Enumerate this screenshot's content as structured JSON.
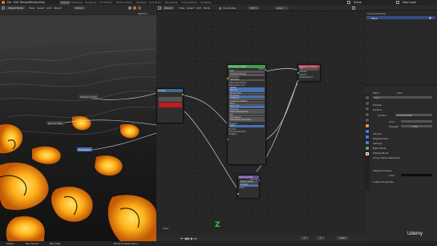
{
  "topbar": {
    "menus": [
      "File",
      "Edit",
      "Render",
      "Window",
      "Help"
    ],
    "workspaces": [
      "Layout",
      "Modeling",
      "Sculpting",
      "UV Editing",
      "Texture Paint",
      "Shading",
      "Animation",
      "Rendering",
      "Compositing",
      "Scripting"
    ],
    "active_workspace": "Layout",
    "scene": "Scene",
    "view_layer": "View Layer"
  },
  "viewport": {
    "mode": "Object Mode",
    "menus": [
      "View",
      "Select",
      "Add",
      "Object"
    ],
    "transform": "Global",
    "labels": [
      "Displacement",
      "Normal Map",
      "Principled"
    ],
    "header_extra": "Options"
  },
  "node_editor": {
    "editor_type": "Object",
    "menus": [
      "View",
      "Select",
      "Add",
      "Node"
    ],
    "use_nodes_label": "Use Nodes",
    "slot": "Slot 1",
    "material": "Lava",
    "footer_label": "Lava",
    "gizmo_axis": "Z"
  },
  "nodes": {
    "bsdf": {
      "title": "Principled BSDF",
      "rows": [
        "BSDF",
        "GGX",
        "Christensen-Burley",
        "Base Color",
        "Subsurface",
        "Subsurface Radius",
        "Subsurface Color",
        "Metallic",
        "Specular",
        "Specular Tint",
        "Roughness",
        "Anisotropic",
        "Anisotropic Rotation",
        "Sheen",
        "Sheen Tint",
        "Clearcoat",
        "Clearcoat Roughness",
        "IOR",
        "Transmission",
        "Transmission Roughness",
        "Emission",
        "Alpha",
        "Normal",
        "Clearcoat Normal",
        "Tangent"
      ]
    },
    "output": {
      "title": "Material Output",
      "rows": [
        "All",
        "Surface",
        "Volume",
        "Displacement"
      ]
    },
    "normal": {
      "title": "Normal Map",
      "rows": [
        "Normal",
        "Tangent Space",
        "Strength",
        "Color"
      ]
    },
    "left": {
      "title": "Image"
    }
  },
  "outliner": {
    "title": "Scene Collection",
    "items": [
      "Scene Collection",
      "Plane"
    ]
  },
  "properties": {
    "object_name": "Plane",
    "tab_label": "Lava",
    "sections": [
      "Preview",
      "Surface",
      "Volume",
      "Displacement",
      "Settings"
    ],
    "surface_label": "Surface",
    "surface_value": "Principled BSDF",
    "displacement_label": "Displacement",
    "color_label": "Color",
    "strength_label": "Strength",
    "strength_value": "1.000",
    "subsections": [
      "Volume",
      "Displacement",
      "Settings",
      "Blend Mode",
      "Shadow Mode",
      "Screen Space Refraction"
    ],
    "viewport_display": "Viewport Display",
    "custom_properties": "Custom Properties",
    "color_header": "Color"
  },
  "timeline": {
    "frame": "1",
    "start": "1",
    "end": "250"
  },
  "statusbar": {
    "left_items": [
      "Select",
      "Box Select",
      "Pan View",
      "Node Context Menu"
    ],
    "watermark": "Udemy"
  },
  "colors": {
    "accent": "#4772b3",
    "bsdf_header": "#3f9b4c",
    "output_header": "#a23a4a",
    "normal_header": "#6a4ba0",
    "image_header": "#3f6a8e",
    "gizmo_z": "#2ecc40"
  }
}
